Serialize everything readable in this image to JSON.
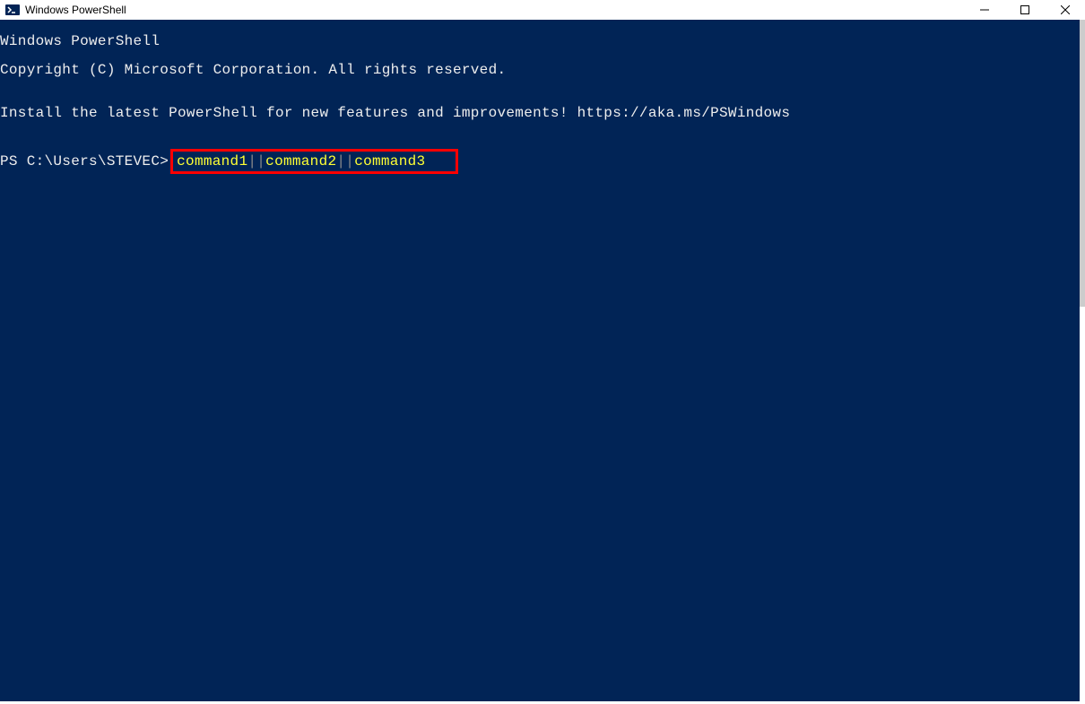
{
  "titlebar": {
    "title": "Windows PowerShell"
  },
  "terminal": {
    "line1": "Windows PowerShell",
    "line2": "Copyright (C) Microsoft Corporation. All rights reserved.",
    "line3": "",
    "line4": "Install the latest PowerShell for new features and improvements! https://aka.ms/PSWindows",
    "line5": "",
    "prompt": "PS C:\\Users\\STEVEC>",
    "cmd1": "command1",
    "sep1": "||",
    "cmd2": "command2",
    "sep2": "||",
    "cmd3": "command3"
  },
  "colors": {
    "terminalBg": "#012456",
    "terminalFg": "#eeeeee",
    "cmdYellow": "#ffff33",
    "pipeGray": "#888888",
    "highlightBorder": "#ff0000"
  }
}
